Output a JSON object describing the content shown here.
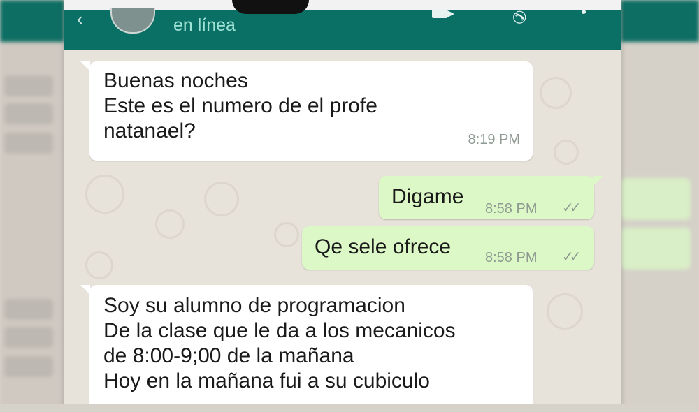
{
  "header": {
    "status": "en línea",
    "icons": {
      "back": "back-arrow-icon",
      "avatar": "contact-avatar",
      "video": "video-call-icon",
      "call": "phone-call-icon",
      "menu": "overflow-menu-icon"
    },
    "color": "#0a7065"
  },
  "messages": [
    {
      "direction": "incoming",
      "text": "Buenas noches\nEste es el numero de el profe\nnatanael?",
      "time": "8:19 PM"
    },
    {
      "direction": "outgoing",
      "text": "Digame",
      "time": "8:58 PM",
      "ticks": "✓✓"
    },
    {
      "direction": "outgoing",
      "text": "Qe sele ofrece",
      "time": "8:58 PM",
      "ticks": "✓✓"
    },
    {
      "direction": "incoming",
      "text": "Soy su alumno de programacion\nDe la clase que le da a los mecanicos\nde 8:00-9;00 de la mañana\nHoy en la mañana fui a su cubiculo"
    }
  ],
  "colors": {
    "incoming_bubble": "#ffffff",
    "outgoing_bubble": "#dcf8c6",
    "wallpaper": "#e7e2da"
  }
}
